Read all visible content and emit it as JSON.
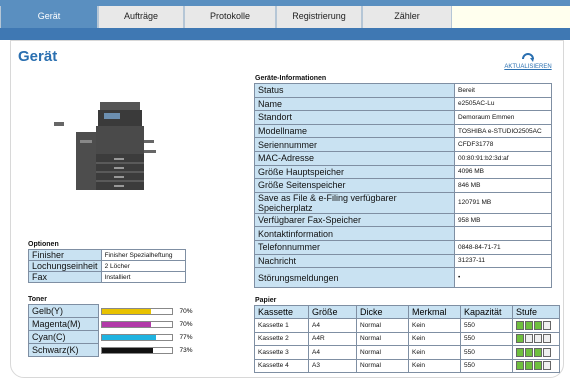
{
  "nav": {
    "tabs": [
      {
        "label": "Gerät"
      },
      {
        "label": "Aufträge"
      },
      {
        "label": "Protokolle"
      },
      {
        "label": "Registrierung"
      },
      {
        "label": "Zähler"
      }
    ]
  },
  "page": {
    "title": "Gerät",
    "refresh_label": "AKTUALISIEREN"
  },
  "device_info": {
    "heading": "Geräte-Informationen",
    "rows": [
      {
        "label": "Status",
        "value": "Bereit"
      },
      {
        "label": "Name",
        "value": "e2505AC-Lu"
      },
      {
        "label": "Standort",
        "value": "Demoraum Emmen"
      },
      {
        "label": "Modellname",
        "value": "TOSHIBA e-STUDIO2505AC"
      },
      {
        "label": "Seriennummer",
        "value": "CFDF31778"
      },
      {
        "label": "MAC-Adresse",
        "value": "00:80:91:b2:3d:af"
      },
      {
        "label": "Größe Hauptspeicher",
        "value": "4096 MB"
      },
      {
        "label": "Größe Seitenspeicher",
        "value": "846 MB"
      },
      {
        "label": "Save as File & e-Filing verfügbarer Speicherplatz",
        "value": "120791 MB"
      },
      {
        "label": "Verfügbarer Fax-Speicher",
        "value": "958 MB"
      },
      {
        "label": "Kontaktinformation",
        "value": ""
      },
      {
        "label": "Telefonnummer",
        "value": "0848-84-71-71"
      },
      {
        "label": "Nachricht",
        "value": "31237-11"
      },
      {
        "label": "Störungsmeldungen",
        "value": "•"
      }
    ]
  },
  "options": {
    "heading": "Optionen",
    "rows": [
      {
        "label": "Finisher",
        "value": "Finisher Spezialheftung"
      },
      {
        "label": "Lochungseinheit",
        "value": "2 Löcher"
      },
      {
        "label": "Fax",
        "value": "Installiert"
      }
    ]
  },
  "toner": {
    "heading": "Toner",
    "rows": [
      {
        "label": "Gelb(Y)",
        "percent": 70,
        "percent_text": "70%",
        "color": "#e8c200"
      },
      {
        "label": "Magenta(M)",
        "percent": 70,
        "percent_text": "70%",
        "color": "#b23aa8"
      },
      {
        "label": "Cyan(C)",
        "percent": 77,
        "percent_text": "77%",
        "color": "#1fb3e0"
      },
      {
        "label": "Schwarz(K)",
        "percent": 73,
        "percent_text": "73%",
        "color": "#111111"
      }
    ]
  },
  "paper": {
    "heading": "Papier",
    "columns": [
      "Kassette",
      "Größe",
      "Dicke",
      "Merkmal",
      "Kapazität",
      "Stufe"
    ],
    "rows": [
      {
        "kassette": "Kassette 1",
        "groesse": "A4",
        "dicke": "Normal",
        "merkmal": "Kein",
        "kapazitaet": "550",
        "level": 3
      },
      {
        "kassette": "Kassette 2",
        "groesse": "A4R",
        "dicke": "Normal",
        "merkmal": "Kein",
        "kapazitaet": "550",
        "level": 1
      },
      {
        "kassette": "Kassette 3",
        "groesse": "A4",
        "dicke": "Normal",
        "merkmal": "Kein",
        "kapazitaet": "550",
        "level": 3
      },
      {
        "kassette": "Kassette 4",
        "groesse": "A3",
        "dicke": "Normal",
        "merkmal": "Kein",
        "kapazitaet": "550",
        "level": 3
      }
    ]
  }
}
